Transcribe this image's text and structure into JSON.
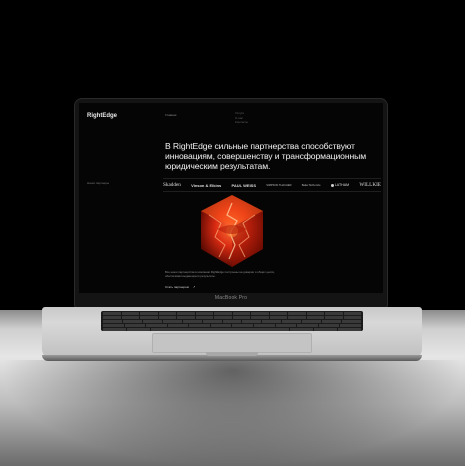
{
  "site": {
    "logo": "RightEdge",
    "nav_item": "Главная",
    "nav_group": [
      "Услуги",
      "О нас",
      "Контакты"
    ],
    "headline": "В RightEdge сильные партнерства способствуют инновациям, совершенству и трансформационным юридическим результатам.",
    "sidebar_label": "Наши партнеры",
    "partners": [
      "Skadden",
      "Vinson & Elkins",
      "PAUL WEISS",
      "SIMPSON THACHER",
      "Baker McKenzie",
      "LATHAM",
      "WILLKIE"
    ],
    "body_text": "Все наши партнерства в компании RightEdge построены на доверии и общих целях, обеспечивая выдающиеся результаты.",
    "cta_label": "Стать партнером",
    "cta_arrow": "↗"
  },
  "device": {
    "chin_label": "MacBook Pro"
  },
  "colors": {
    "background": "#000000",
    "accent_crystal": "#d92a12",
    "screen_bg": "#050505"
  }
}
